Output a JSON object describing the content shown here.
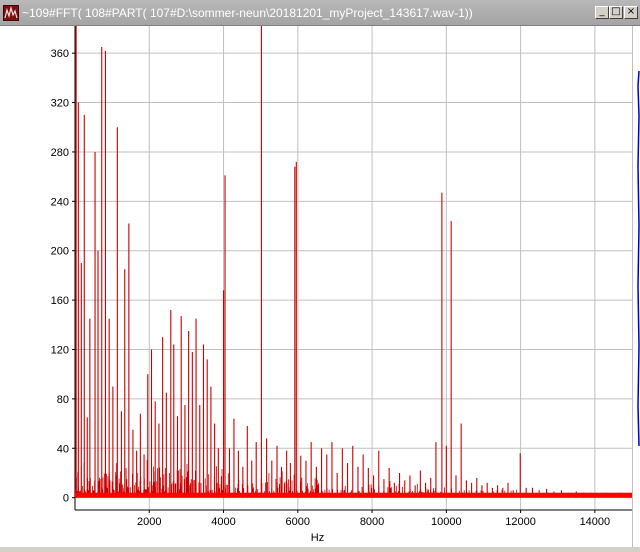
{
  "window": {
    "title": "~109#FFT( 108#PART( 107#D:\\sommer-neun\\20181201_myProject_143617.wav-1))",
    "minimize_glyph": "_",
    "maximize_glyph": "□",
    "close_glyph": "×"
  },
  "colors": {
    "spectrum": "#cc0000",
    "baseline": "#ff0000",
    "grid": "#c0c0c0",
    "background": "#ffffff",
    "titlebar": "#a8a8a8",
    "edge_trace": "#0000cc"
  },
  "chart_data": {
    "type": "line",
    "title": "",
    "xlabel": "Hz",
    "ylabel": "",
    "xlim": [
      0,
      15000
    ],
    "ylim": [
      -10,
      382
    ],
    "grid": true,
    "x_ticks": [
      "2000",
      "4000",
      "6000",
      "8000",
      "10000",
      "12000",
      "14000"
    ],
    "y_ticks": [
      "0",
      "40",
      "80",
      "120",
      "160",
      "200",
      "240",
      "280",
      "320",
      "360"
    ],
    "series": [
      {
        "peaks": [
          {
            "x": 30,
            "y": 382
          },
          {
            "x": 90,
            "y": 320
          },
          {
            "x": 170,
            "y": 190
          },
          {
            "x": 250,
            "y": 310
          },
          {
            "x": 330,
            "y": 65
          },
          {
            "x": 400,
            "y": 145
          },
          {
            "x": 540,
            "y": 280
          },
          {
            "x": 620,
            "y": 200
          },
          {
            "x": 720,
            "y": 365
          },
          {
            "x": 820,
            "y": 362
          },
          {
            "x": 920,
            "y": 145
          },
          {
            "x": 1020,
            "y": 90
          },
          {
            "x": 1140,
            "y": 300
          },
          {
            "x": 1250,
            "y": 70
          },
          {
            "x": 1340,
            "y": 185
          },
          {
            "x": 1450,
            "y": 222
          },
          {
            "x": 1560,
            "y": 55
          },
          {
            "x": 1660,
            "y": 38
          },
          {
            "x": 1760,
            "y": 68
          },
          {
            "x": 1860,
            "y": 35
          },
          {
            "x": 1960,
            "y": 100
          },
          {
            "x": 2060,
            "y": 120
          },
          {
            "x": 2160,
            "y": 78
          },
          {
            "x": 2260,
            "y": 60
          },
          {
            "x": 2360,
            "y": 130
          },
          {
            "x": 2460,
            "y": 85
          },
          {
            "x": 2580,
            "y": 152
          },
          {
            "x": 2660,
            "y": 124
          },
          {
            "x": 2760,
            "y": 66
          },
          {
            "x": 2860,
            "y": 147
          },
          {
            "x": 2960,
            "y": 75
          },
          {
            "x": 3060,
            "y": 135
          },
          {
            "x": 3160,
            "y": 118
          },
          {
            "x": 3260,
            "y": 145
          },
          {
            "x": 3360,
            "y": 75
          },
          {
            "x": 3460,
            "y": 124
          },
          {
            "x": 3560,
            "y": 112
          },
          {
            "x": 3660,
            "y": 90
          },
          {
            "x": 3760,
            "y": 60
          },
          {
            "x": 3860,
            "y": 40
          },
          {
            "x": 4000,
            "y": 168
          },
          {
            "x": 4040,
            "y": 261
          },
          {
            "x": 4160,
            "y": 40
          },
          {
            "x": 4280,
            "y": 64
          },
          {
            "x": 4400,
            "y": 38
          },
          {
            "x": 4520,
            "y": 25
          },
          {
            "x": 4640,
            "y": 58
          },
          {
            "x": 4760,
            "y": 30
          },
          {
            "x": 4880,
            "y": 45
          },
          {
            "x": 5020,
            "y": 382
          },
          {
            "x": 5160,
            "y": 48
          },
          {
            "x": 5300,
            "y": 30
          },
          {
            "x": 5440,
            "y": 42
          },
          {
            "x": 5560,
            "y": 25
          },
          {
            "x": 5700,
            "y": 38
          },
          {
            "x": 5800,
            "y": 28
          },
          {
            "x": 5920,
            "y": 268
          },
          {
            "x": 5960,
            "y": 272
          },
          {
            "x": 6080,
            "y": 34
          },
          {
            "x": 6220,
            "y": 30
          },
          {
            "x": 6360,
            "y": 45
          },
          {
            "x": 6500,
            "y": 25
          },
          {
            "x": 6640,
            "y": 40
          },
          {
            "x": 6780,
            "y": 35
          },
          {
            "x": 6920,
            "y": 45
          },
          {
            "x": 7060,
            "y": 20
          },
          {
            "x": 7200,
            "y": 40
          },
          {
            "x": 7340,
            "y": 28
          },
          {
            "x": 7480,
            "y": 42
          },
          {
            "x": 7620,
            "y": 25
          },
          {
            "x": 7760,
            "y": 35
          },
          {
            "x": 7900,
            "y": 24
          },
          {
            "x": 8040,
            "y": 18
          },
          {
            "x": 8180,
            "y": 38
          },
          {
            "x": 8320,
            "y": 15
          },
          {
            "x": 8460,
            "y": 24
          },
          {
            "x": 8600,
            "y": 12
          },
          {
            "x": 8740,
            "y": 20
          },
          {
            "x": 8880,
            "y": 14
          },
          {
            "x": 9020,
            "y": 18
          },
          {
            "x": 9160,
            "y": 10
          },
          {
            "x": 9300,
            "y": 22
          },
          {
            "x": 9440,
            "y": 12
          },
          {
            "x": 9580,
            "y": 16
          },
          {
            "x": 9720,
            "y": 45
          },
          {
            "x": 9880,
            "y": 247
          },
          {
            "x": 10000,
            "y": 42
          },
          {
            "x": 10130,
            "y": 224
          },
          {
            "x": 10260,
            "y": 18
          },
          {
            "x": 10400,
            "y": 60
          },
          {
            "x": 10540,
            "y": 14
          },
          {
            "x": 10680,
            "y": 12
          },
          {
            "x": 10820,
            "y": 16
          },
          {
            "x": 10960,
            "y": 10
          },
          {
            "x": 11100,
            "y": 12
          },
          {
            "x": 11240,
            "y": 8
          },
          {
            "x": 11380,
            "y": 10
          },
          {
            "x": 11520,
            "y": 8
          },
          {
            "x": 11660,
            "y": 12
          },
          {
            "x": 11800,
            "y": 6
          },
          {
            "x": 11990,
            "y": 36
          },
          {
            "x": 12150,
            "y": 8
          },
          {
            "x": 12320,
            "y": 8
          },
          {
            "x": 12500,
            "y": 6
          },
          {
            "x": 12700,
            "y": 7
          },
          {
            "x": 12900,
            "y": 5
          },
          {
            "x": 13100,
            "y": 6
          },
          {
            "x": 13300,
            "y": 4
          },
          {
            "x": 13500,
            "y": 5
          },
          {
            "x": 13700,
            "y": 4
          },
          {
            "x": 13900,
            "y": 4
          },
          {
            "x": 14100,
            "y": 3
          },
          {
            "x": 14300,
            "y": 4
          },
          {
            "x": 14500,
            "y": 3
          },
          {
            "x": 14700,
            "y": 4
          },
          {
            "x": 14900,
            "y": 3
          }
        ]
      }
    ]
  }
}
